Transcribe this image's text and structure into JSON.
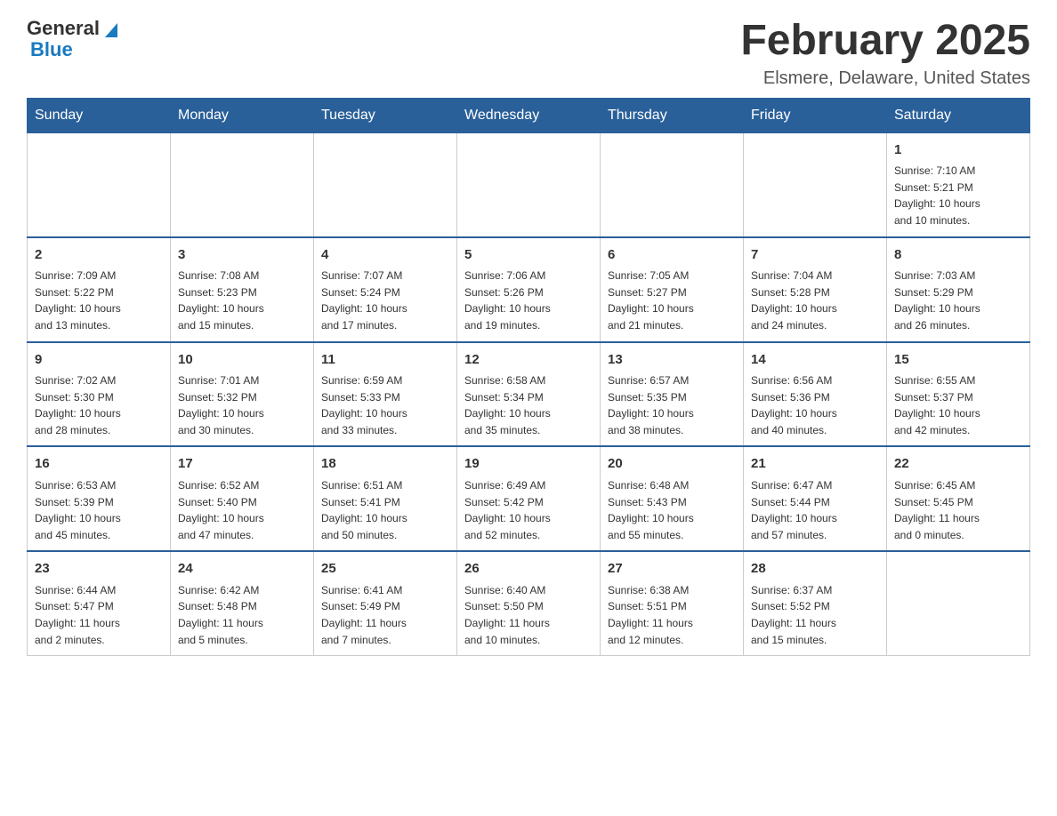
{
  "header": {
    "logo_general": "General",
    "logo_blue": "Blue",
    "month_title": "February 2025",
    "location": "Elsmere, Delaware, United States"
  },
  "weekdays": [
    "Sunday",
    "Monday",
    "Tuesday",
    "Wednesday",
    "Thursday",
    "Friday",
    "Saturday"
  ],
  "weeks": [
    [
      {
        "day": "",
        "info": ""
      },
      {
        "day": "",
        "info": ""
      },
      {
        "day": "",
        "info": ""
      },
      {
        "day": "",
        "info": ""
      },
      {
        "day": "",
        "info": ""
      },
      {
        "day": "",
        "info": ""
      },
      {
        "day": "1",
        "info": "Sunrise: 7:10 AM\nSunset: 5:21 PM\nDaylight: 10 hours\nand 10 minutes."
      }
    ],
    [
      {
        "day": "2",
        "info": "Sunrise: 7:09 AM\nSunset: 5:22 PM\nDaylight: 10 hours\nand 13 minutes."
      },
      {
        "day": "3",
        "info": "Sunrise: 7:08 AM\nSunset: 5:23 PM\nDaylight: 10 hours\nand 15 minutes."
      },
      {
        "day": "4",
        "info": "Sunrise: 7:07 AM\nSunset: 5:24 PM\nDaylight: 10 hours\nand 17 minutes."
      },
      {
        "day": "5",
        "info": "Sunrise: 7:06 AM\nSunset: 5:26 PM\nDaylight: 10 hours\nand 19 minutes."
      },
      {
        "day": "6",
        "info": "Sunrise: 7:05 AM\nSunset: 5:27 PM\nDaylight: 10 hours\nand 21 minutes."
      },
      {
        "day": "7",
        "info": "Sunrise: 7:04 AM\nSunset: 5:28 PM\nDaylight: 10 hours\nand 24 minutes."
      },
      {
        "day": "8",
        "info": "Sunrise: 7:03 AM\nSunset: 5:29 PM\nDaylight: 10 hours\nand 26 minutes."
      }
    ],
    [
      {
        "day": "9",
        "info": "Sunrise: 7:02 AM\nSunset: 5:30 PM\nDaylight: 10 hours\nand 28 minutes."
      },
      {
        "day": "10",
        "info": "Sunrise: 7:01 AM\nSunset: 5:32 PM\nDaylight: 10 hours\nand 30 minutes."
      },
      {
        "day": "11",
        "info": "Sunrise: 6:59 AM\nSunset: 5:33 PM\nDaylight: 10 hours\nand 33 minutes."
      },
      {
        "day": "12",
        "info": "Sunrise: 6:58 AM\nSunset: 5:34 PM\nDaylight: 10 hours\nand 35 minutes."
      },
      {
        "day": "13",
        "info": "Sunrise: 6:57 AM\nSunset: 5:35 PM\nDaylight: 10 hours\nand 38 minutes."
      },
      {
        "day": "14",
        "info": "Sunrise: 6:56 AM\nSunset: 5:36 PM\nDaylight: 10 hours\nand 40 minutes."
      },
      {
        "day": "15",
        "info": "Sunrise: 6:55 AM\nSunset: 5:37 PM\nDaylight: 10 hours\nand 42 minutes."
      }
    ],
    [
      {
        "day": "16",
        "info": "Sunrise: 6:53 AM\nSunset: 5:39 PM\nDaylight: 10 hours\nand 45 minutes."
      },
      {
        "day": "17",
        "info": "Sunrise: 6:52 AM\nSunset: 5:40 PM\nDaylight: 10 hours\nand 47 minutes."
      },
      {
        "day": "18",
        "info": "Sunrise: 6:51 AM\nSunset: 5:41 PM\nDaylight: 10 hours\nand 50 minutes."
      },
      {
        "day": "19",
        "info": "Sunrise: 6:49 AM\nSunset: 5:42 PM\nDaylight: 10 hours\nand 52 minutes."
      },
      {
        "day": "20",
        "info": "Sunrise: 6:48 AM\nSunset: 5:43 PM\nDaylight: 10 hours\nand 55 minutes."
      },
      {
        "day": "21",
        "info": "Sunrise: 6:47 AM\nSunset: 5:44 PM\nDaylight: 10 hours\nand 57 minutes."
      },
      {
        "day": "22",
        "info": "Sunrise: 6:45 AM\nSunset: 5:45 PM\nDaylight: 11 hours\nand 0 minutes."
      }
    ],
    [
      {
        "day": "23",
        "info": "Sunrise: 6:44 AM\nSunset: 5:47 PM\nDaylight: 11 hours\nand 2 minutes."
      },
      {
        "day": "24",
        "info": "Sunrise: 6:42 AM\nSunset: 5:48 PM\nDaylight: 11 hours\nand 5 minutes."
      },
      {
        "day": "25",
        "info": "Sunrise: 6:41 AM\nSunset: 5:49 PM\nDaylight: 11 hours\nand 7 minutes."
      },
      {
        "day": "26",
        "info": "Sunrise: 6:40 AM\nSunset: 5:50 PM\nDaylight: 11 hours\nand 10 minutes."
      },
      {
        "day": "27",
        "info": "Sunrise: 6:38 AM\nSunset: 5:51 PM\nDaylight: 11 hours\nand 12 minutes."
      },
      {
        "day": "28",
        "info": "Sunrise: 6:37 AM\nSunset: 5:52 PM\nDaylight: 11 hours\nand 15 minutes."
      },
      {
        "day": "",
        "info": ""
      }
    ]
  ]
}
